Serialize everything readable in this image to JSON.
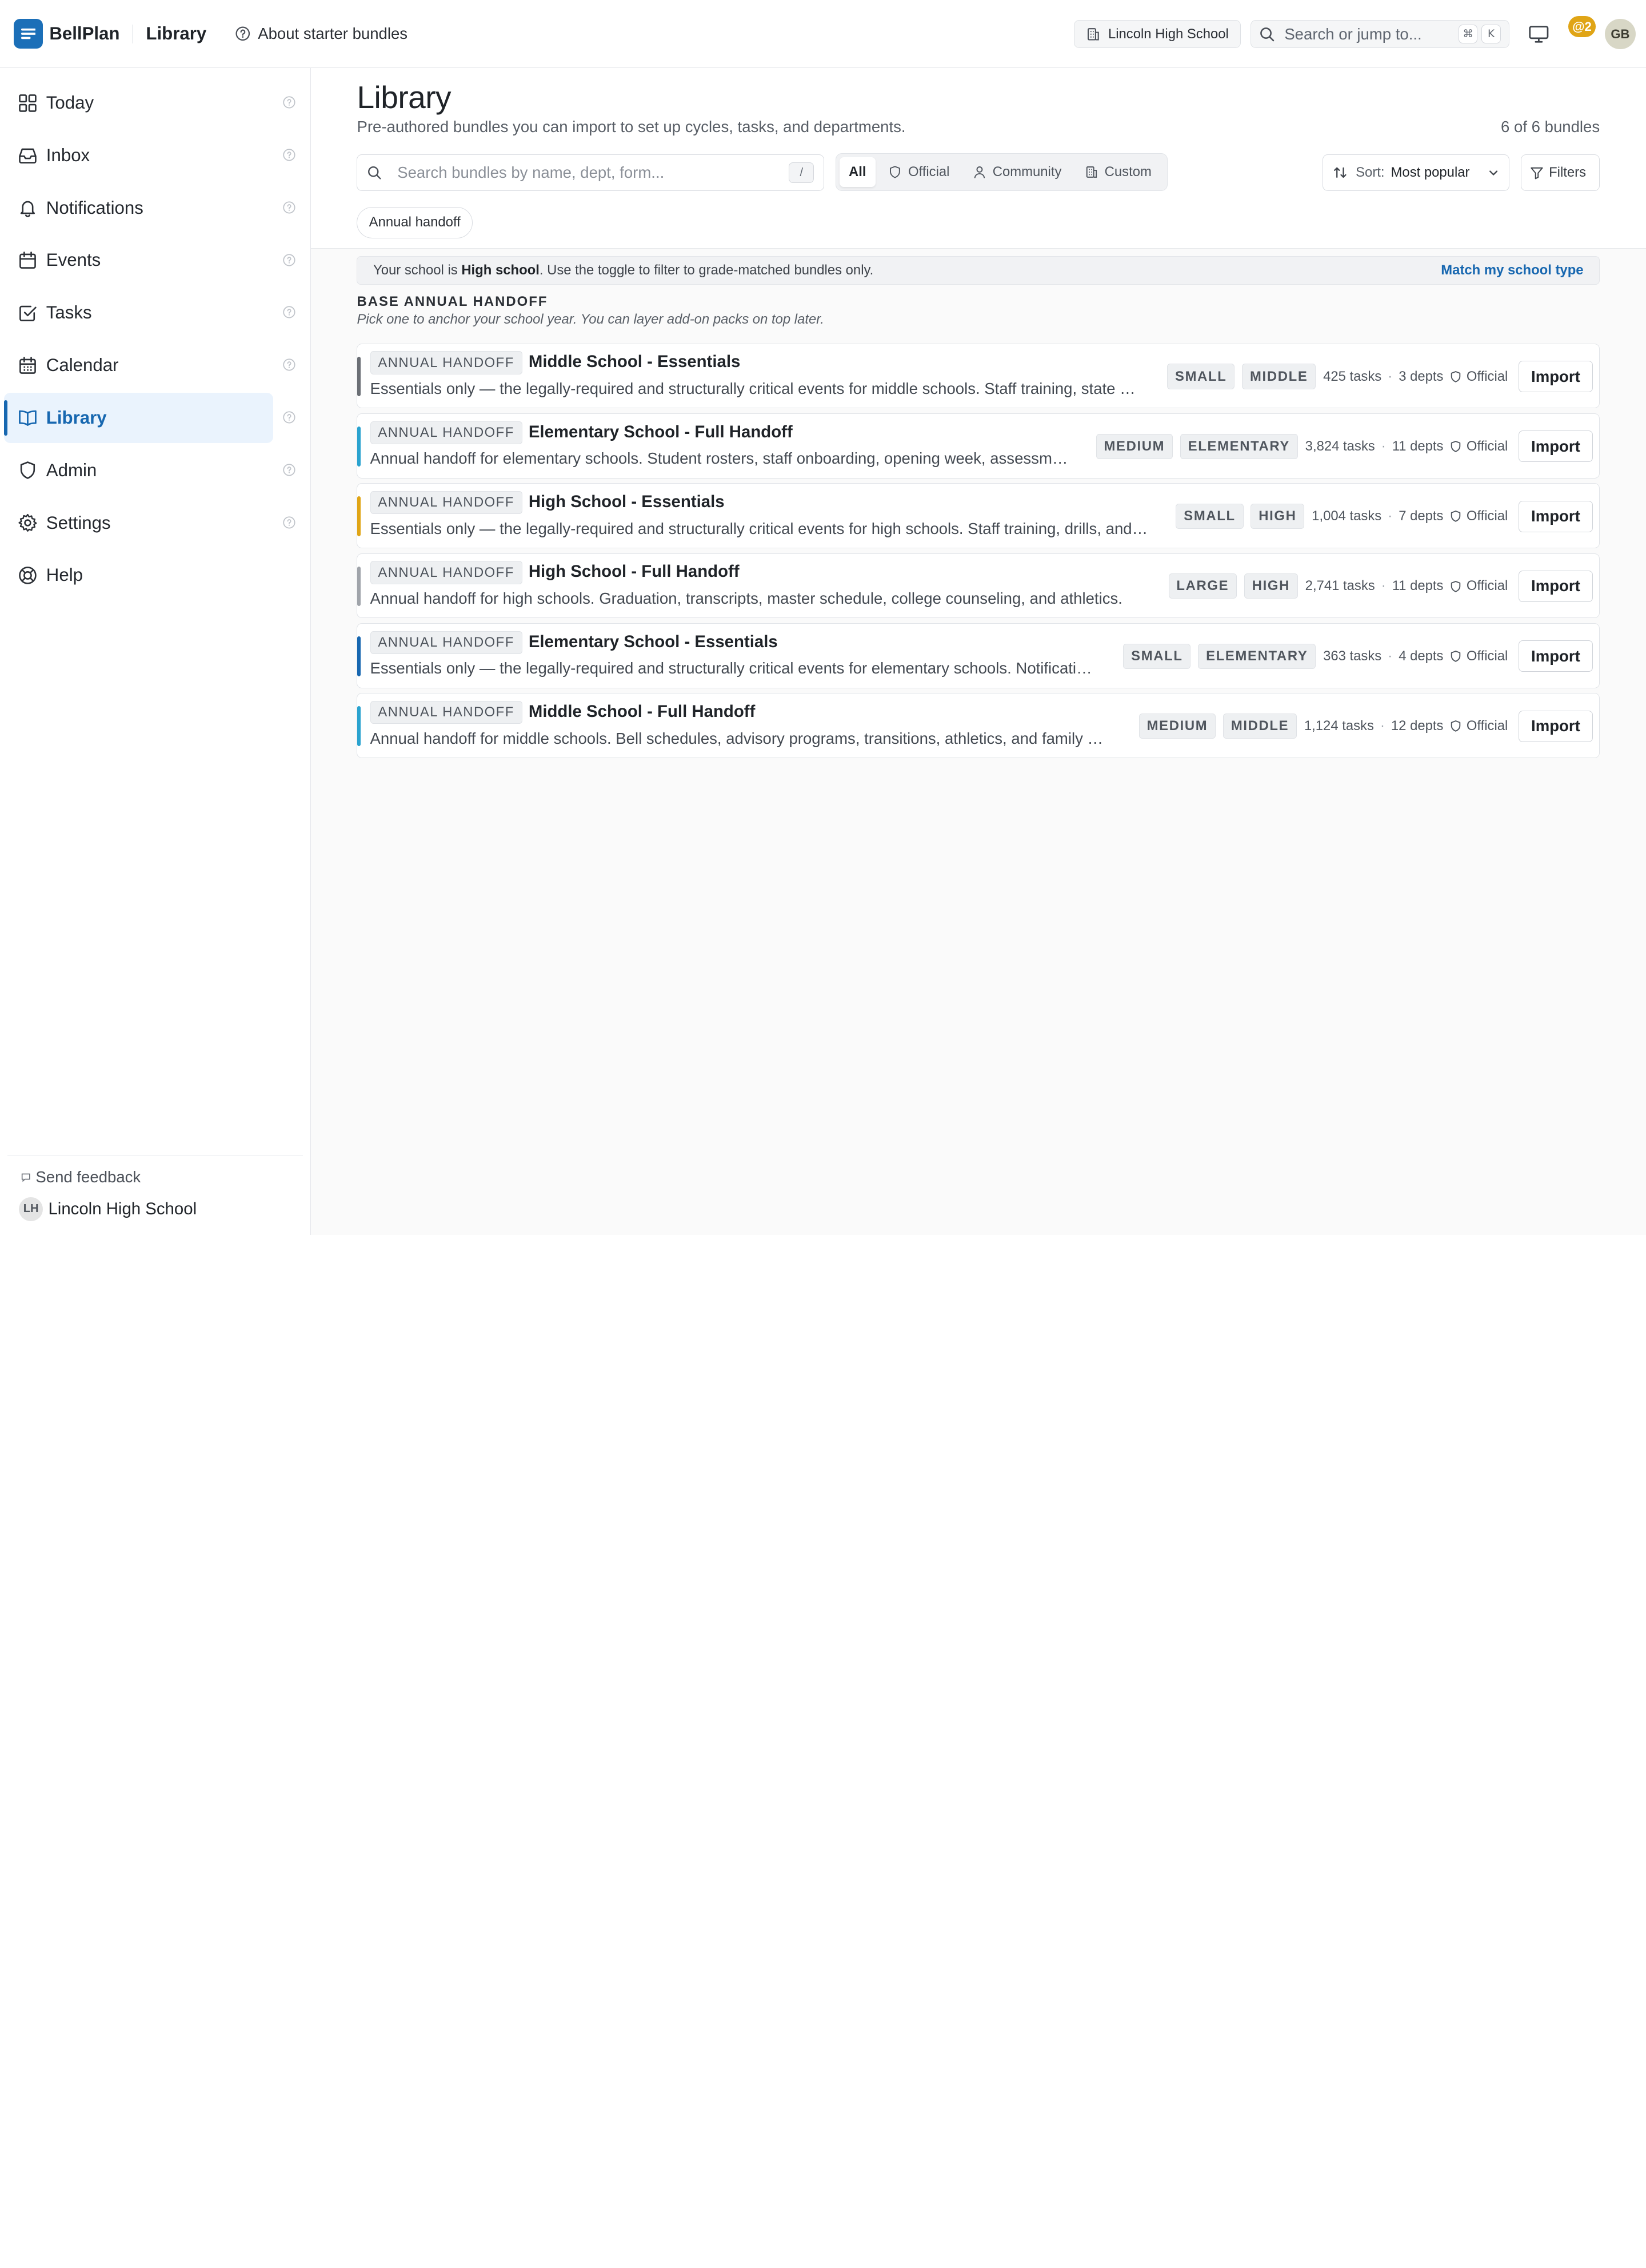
{
  "app": {
    "name": "BellPlan",
    "page": "Library",
    "about_link": "About starter bundles"
  },
  "topbar": {
    "school": "Lincoln High School",
    "search_placeholder": "Search or jump to...",
    "shortcut_keys": [
      "⌘",
      "K"
    ],
    "mentions_badge": "@2",
    "user_initials": "GB"
  },
  "sidebar": {
    "items": [
      {
        "label": "Today",
        "icon": "grid-icon",
        "active": false,
        "help": true
      },
      {
        "label": "Inbox",
        "icon": "inbox-icon",
        "active": false,
        "help": true
      },
      {
        "label": "Notifications",
        "icon": "bell-icon",
        "active": false,
        "help": true
      },
      {
        "label": "Events",
        "icon": "calendar-icon",
        "active": false,
        "help": true
      },
      {
        "label": "Tasks",
        "icon": "checkbox-icon",
        "active": false,
        "help": true
      },
      {
        "label": "Calendar",
        "icon": "calendar-grid-icon",
        "active": false,
        "help": true
      },
      {
        "label": "Library",
        "icon": "book-icon",
        "active": true,
        "help": true
      },
      {
        "label": "Admin",
        "icon": "shield-icon",
        "active": false,
        "help": true
      },
      {
        "label": "Settings",
        "icon": "gear-icon",
        "active": false,
        "help": true
      },
      {
        "label": "Help",
        "icon": "lifebuoy-icon",
        "active": false,
        "help": false
      }
    ],
    "feedback": "Send feedback",
    "school_initials": "LH",
    "school_name": "Lincoln High School"
  },
  "main": {
    "title": "Library",
    "subtitle": "Pre-authored bundles you can import to set up cycles, tasks, and departments.",
    "count": "6 of 6 bundles",
    "search_placeholder": "Search bundles by name, dept, form...",
    "search_shortcut": "/",
    "filters": [
      {
        "label": "All",
        "icon": "",
        "active": true
      },
      {
        "label": "Official",
        "icon": "shield-icon",
        "active": false
      },
      {
        "label": "Community",
        "icon": "person-icon",
        "active": false
      },
      {
        "label": "Custom",
        "icon": "building-icon",
        "active": false
      }
    ],
    "sort_label": "Sort:",
    "sort_value": "Most popular",
    "filters_button": "Filters",
    "active_chip": "Annual handoff",
    "notice": {
      "prefix": "Your school is ",
      "school_type": "High school",
      "suffix": ". Use the toggle to filter to grade-matched bundles only.",
      "link": "Match my school type"
    },
    "section_title": "BASE ANNUAL HANDOFF",
    "section_subtitle": "Pick one to anchor your school year. You can layer add-on packs on top later.",
    "import_label": "Import",
    "official_label": "Official",
    "bundles": [
      {
        "tag": "ANNUAL HANDOFF",
        "name": "Middle School - Essentials",
        "desc": "Essentials only — the legally-required and structurally critical events for middle schools. Staff training, state testing windows, and safety drills.",
        "size": "SMALL",
        "level": "MIDDLE",
        "tasks": "425 tasks",
        "depts": "3 depts",
        "accent": "#6b6f75",
        "desc_width": 733
      },
      {
        "tag": "ANNUAL HANDOFF",
        "name": "Elementary School - Full Handoff",
        "desc": "Annual handoff for elementary schools. Student rosters, staff onboarding, opening week, assessments, and family communications.",
        "size": "MEDIUM",
        "level": "ELEMENTARY",
        "tasks": "3,824 tasks",
        "depts": "11 depts",
        "accent": "#2aa3cf",
        "desc_width": 666
      },
      {
        "tag": "ANNUAL HANDOFF",
        "name": "High School - Essentials",
        "desc": "Essentials only — the legally-required and structurally critical events for high schools. Staff training, drills, and testing calendars.",
        "size": "SMALL",
        "level": "HIGH",
        "tasks": "1,004 tasks",
        "depts": "7 depts",
        "accent": "#e0a516",
        "desc_width": 743
      },
      {
        "tag": "ANNUAL HANDOFF",
        "name": "High School - Full Handoff",
        "desc": "Annual handoff for high schools. Graduation, transcripts, master schedule, college counseling, and athletics.",
        "size": "LARGE",
        "level": "HIGH",
        "tasks": "2,741 tasks",
        "depts": "11 depts",
        "accent": "#a0a4aa",
        "desc_width": 736
      },
      {
        "tag": "ANNUAL HANDOFF",
        "name": "Elementary School - Essentials",
        "desc": "Essentials only — the legally-required and structurally critical events for elementary schools. Notifications, drills, and staff training.",
        "size": "SMALL",
        "level": "ELEMENTARY",
        "tasks": "363 tasks",
        "depts": "4 depts",
        "accent": "#1767b0",
        "desc_width": 694
      },
      {
        "tag": "ANNUAL HANDOFF",
        "name": "Middle School - Full Handoff",
        "desc": "Annual handoff for middle schools. Bell schedules, advisory programs, transitions, athletics, and family events.",
        "size": "MEDIUM",
        "level": "MIDDLE",
        "tasks": "1,124 tasks",
        "depts": "12 depts",
        "accent": "#2aa3cf",
        "desc_width": 704
      }
    ]
  }
}
